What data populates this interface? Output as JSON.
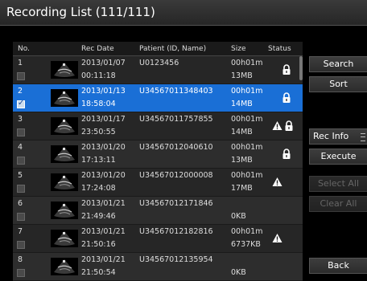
{
  "title": "Recording List  (111/111)",
  "columns": {
    "no": "No.",
    "rec_date": "Rec Date",
    "patient": "Patient (ID, Name)",
    "size": "Size",
    "status": "Status"
  },
  "rows": [
    {
      "no": "1",
      "date": "2013/01/07",
      "time": "00:11:18",
      "patient": "U0123456",
      "duration": "00h01m",
      "size": "13MB",
      "status": [
        "lock-icon"
      ],
      "selected": false,
      "checked": false
    },
    {
      "no": "2",
      "date": "2013/01/13",
      "time": "18:58:04",
      "patient": "U34567011348403",
      "duration": "00h01m",
      "size": "14MB",
      "status": [
        "lock-icon"
      ],
      "selected": true,
      "checked": true
    },
    {
      "no": "3",
      "date": "2013/01/17",
      "time": "23:50:55",
      "patient": "U34567011757855",
      "duration": "00h01m",
      "size": "14MB",
      "status": [
        "warning-icon",
        "lock-icon"
      ],
      "selected": false,
      "checked": false
    },
    {
      "no": "4",
      "date": "2013/01/20",
      "time": "17:13:11",
      "patient": "U34567012040610",
      "duration": "00h01m",
      "size": "13MB",
      "status": [
        "lock-icon"
      ],
      "selected": false,
      "checked": false
    },
    {
      "no": "5",
      "date": "2013/01/20",
      "time": "17:24:08",
      "patient": "U34567012000008",
      "duration": "00h01m",
      "size": "17MB",
      "status": [
        "warning-icon"
      ],
      "selected": false,
      "checked": false
    },
    {
      "no": "6",
      "date": "2013/01/21",
      "time": "21:49:46",
      "patient": "U34567012171846",
      "duration": "",
      "size": "0KB",
      "status": [],
      "selected": false,
      "checked": false
    },
    {
      "no": "7",
      "date": "2013/01/21",
      "time": "21:50:16",
      "patient": "U34567012182816",
      "duration": "00h01m",
      "size": "6737KB",
      "status": [
        "warning-icon"
      ],
      "selected": false,
      "checked": false
    },
    {
      "no": "8",
      "date": "2013/01/21",
      "time": "21:50:54",
      "patient": "U34567012135954",
      "duration": "",
      "size": "0KB",
      "status": [],
      "selected": false,
      "checked": false
    }
  ],
  "buttons": {
    "search": "Search",
    "sort": "Sort",
    "rec_info": "Rec Info",
    "execute": "Execute",
    "select_all": "Select All",
    "clear_all": "Clear All",
    "back": "Back"
  },
  "colors": {
    "selected_row": "#1a6fd6",
    "background": "#000000",
    "row": "#262626",
    "disabled_text": "#666666"
  }
}
